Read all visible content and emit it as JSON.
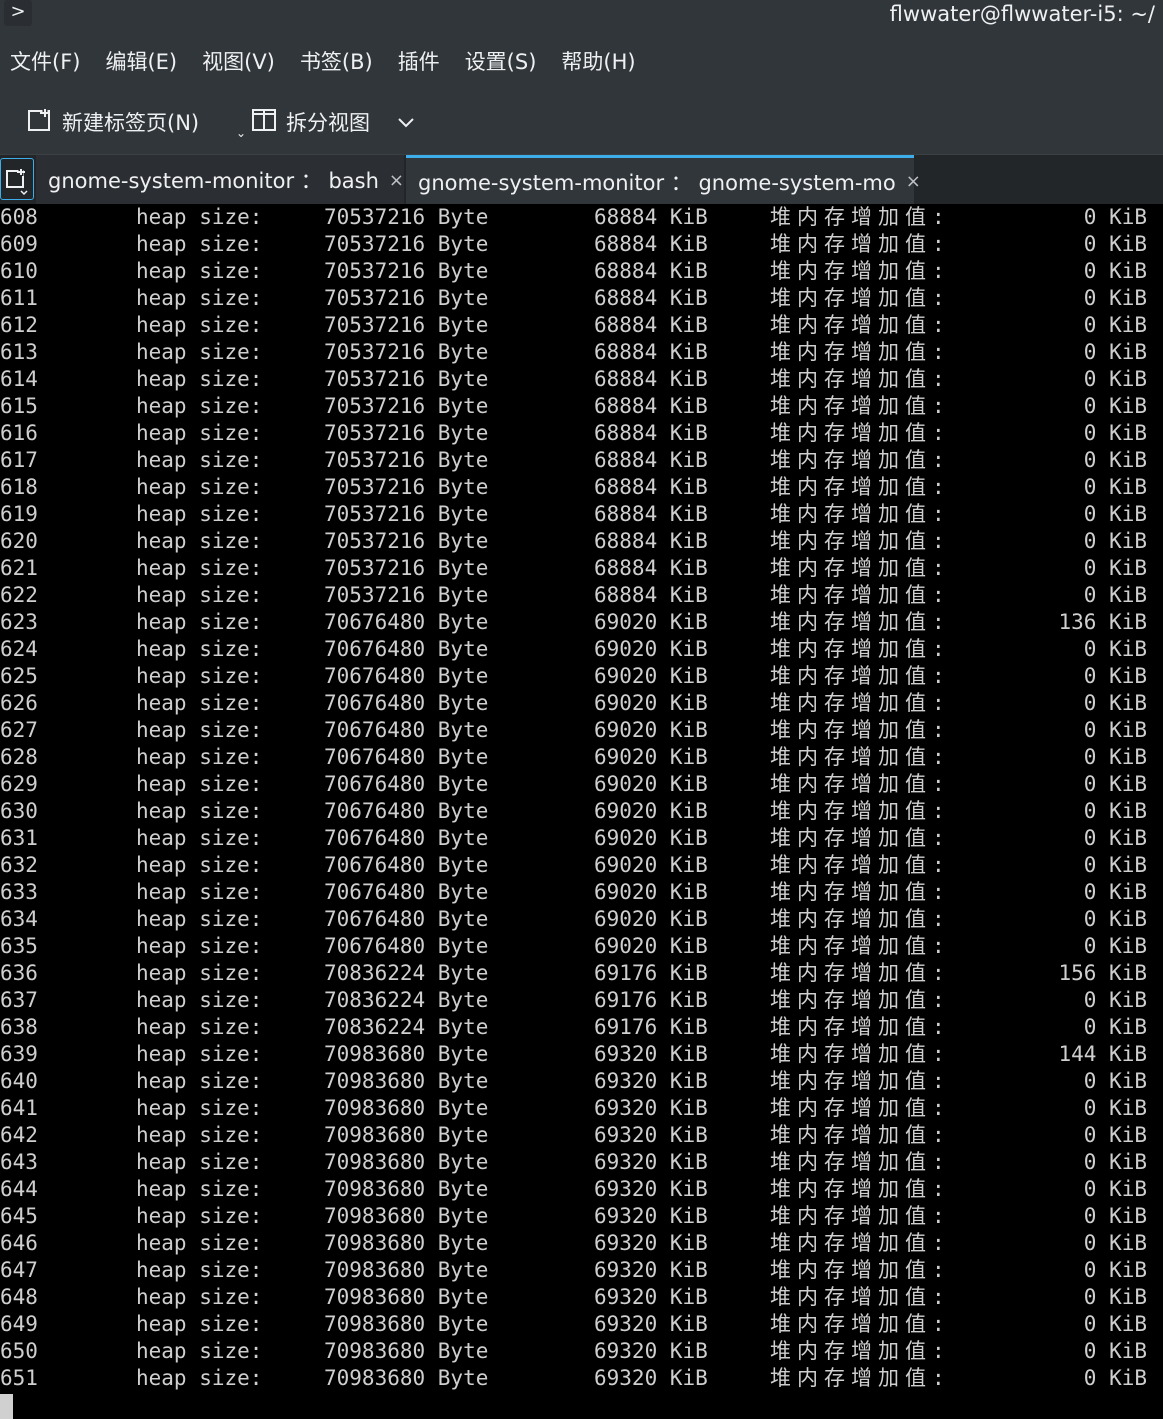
{
  "window": {
    "title": "flwwater@flwwater-i5:  ~/",
    "menu_button": ">"
  },
  "menubar": [
    "文件(F)",
    "编辑(E)",
    "视图(V)",
    "书签(B)",
    "插件",
    "设置(S)",
    "帮助(H)"
  ],
  "toolbar": {
    "new_tab_label": "新建标签页(N)",
    "split_view_label": "拆分视图",
    "new_tab_caret": "⌄",
    "more_glyph": "⌵"
  },
  "tabs": [
    {
      "label": "gnome-system-monitor ： bash",
      "close": "×",
      "active": false
    },
    {
      "label": "gnome-system-monitor ： gnome-system-mo",
      "close": "×",
      "active": true
    }
  ],
  "colors": {
    "accent": "#3daee9",
    "chrome_bg": "#31363b",
    "terminal_bg": "#000000",
    "terminal_fg": "#cfcfcf"
  },
  "terminal": {
    "lines": [
      {
        "idx": "608",
        "label": "heap size:",
        "bytes": "70537216 Byte",
        "kib": "68884 KiB",
        "cn": "堆内存增加值:",
        "inc": "0 KiB"
      },
      {
        "idx": "609",
        "label": "heap size:",
        "bytes": "70537216 Byte",
        "kib": "68884 KiB",
        "cn": "堆内存增加值:",
        "inc": "0 KiB"
      },
      {
        "idx": "610",
        "label": "heap size:",
        "bytes": "70537216 Byte",
        "kib": "68884 KiB",
        "cn": "堆内存增加值:",
        "inc": "0 KiB"
      },
      {
        "idx": "611",
        "label": "heap size:",
        "bytes": "70537216 Byte",
        "kib": "68884 KiB",
        "cn": "堆内存增加值:",
        "inc": "0 KiB"
      },
      {
        "idx": "612",
        "label": "heap size:",
        "bytes": "70537216 Byte",
        "kib": "68884 KiB",
        "cn": "堆内存增加值:",
        "inc": "0 KiB"
      },
      {
        "idx": "613",
        "label": "heap size:",
        "bytes": "70537216 Byte",
        "kib": "68884 KiB",
        "cn": "堆内存增加值:",
        "inc": "0 KiB"
      },
      {
        "idx": "614",
        "label": "heap size:",
        "bytes": "70537216 Byte",
        "kib": "68884 KiB",
        "cn": "堆内存增加值:",
        "inc": "0 KiB"
      },
      {
        "idx": "615",
        "label": "heap size:",
        "bytes": "70537216 Byte",
        "kib": "68884 KiB",
        "cn": "堆内存增加值:",
        "inc": "0 KiB"
      },
      {
        "idx": "616",
        "label": "heap size:",
        "bytes": "70537216 Byte",
        "kib": "68884 KiB",
        "cn": "堆内存增加值:",
        "inc": "0 KiB"
      },
      {
        "idx": "617",
        "label": "heap size:",
        "bytes": "70537216 Byte",
        "kib": "68884 KiB",
        "cn": "堆内存增加值:",
        "inc": "0 KiB"
      },
      {
        "idx": "618",
        "label": "heap size:",
        "bytes": "70537216 Byte",
        "kib": "68884 KiB",
        "cn": "堆内存增加值:",
        "inc": "0 KiB"
      },
      {
        "idx": "619",
        "label": "heap size:",
        "bytes": "70537216 Byte",
        "kib": "68884 KiB",
        "cn": "堆内存增加值:",
        "inc": "0 KiB"
      },
      {
        "idx": "620",
        "label": "heap size:",
        "bytes": "70537216 Byte",
        "kib": "68884 KiB",
        "cn": "堆内存增加值:",
        "inc": "0 KiB"
      },
      {
        "idx": "621",
        "label": "heap size:",
        "bytes": "70537216 Byte",
        "kib": "68884 KiB",
        "cn": "堆内存增加值:",
        "inc": "0 KiB"
      },
      {
        "idx": "622",
        "label": "heap size:",
        "bytes": "70537216 Byte",
        "kib": "68884 KiB",
        "cn": "堆内存增加值:",
        "inc": "0 KiB"
      },
      {
        "idx": "623",
        "label": "heap size:",
        "bytes": "70676480 Byte",
        "kib": "69020 KiB",
        "cn": "堆内存增加值:",
        "inc": "136 KiB"
      },
      {
        "idx": "624",
        "label": "heap size:",
        "bytes": "70676480 Byte",
        "kib": "69020 KiB",
        "cn": "堆内存增加值:",
        "inc": "0 KiB"
      },
      {
        "idx": "625",
        "label": "heap size:",
        "bytes": "70676480 Byte",
        "kib": "69020 KiB",
        "cn": "堆内存增加值:",
        "inc": "0 KiB"
      },
      {
        "idx": "626",
        "label": "heap size:",
        "bytes": "70676480 Byte",
        "kib": "69020 KiB",
        "cn": "堆内存增加值:",
        "inc": "0 KiB"
      },
      {
        "idx": "627",
        "label": "heap size:",
        "bytes": "70676480 Byte",
        "kib": "69020 KiB",
        "cn": "堆内存增加值:",
        "inc": "0 KiB"
      },
      {
        "idx": "628",
        "label": "heap size:",
        "bytes": "70676480 Byte",
        "kib": "69020 KiB",
        "cn": "堆内存增加值:",
        "inc": "0 KiB"
      },
      {
        "idx": "629",
        "label": "heap size:",
        "bytes": "70676480 Byte",
        "kib": "69020 KiB",
        "cn": "堆内存增加值:",
        "inc": "0 KiB"
      },
      {
        "idx": "630",
        "label": "heap size:",
        "bytes": "70676480 Byte",
        "kib": "69020 KiB",
        "cn": "堆内存增加值:",
        "inc": "0 KiB"
      },
      {
        "idx": "631",
        "label": "heap size:",
        "bytes": "70676480 Byte",
        "kib": "69020 KiB",
        "cn": "堆内存增加值:",
        "inc": "0 KiB"
      },
      {
        "idx": "632",
        "label": "heap size:",
        "bytes": "70676480 Byte",
        "kib": "69020 KiB",
        "cn": "堆内存增加值:",
        "inc": "0 KiB"
      },
      {
        "idx": "633",
        "label": "heap size:",
        "bytes": "70676480 Byte",
        "kib": "69020 KiB",
        "cn": "堆内存增加值:",
        "inc": "0 KiB"
      },
      {
        "idx": "634",
        "label": "heap size:",
        "bytes": "70676480 Byte",
        "kib": "69020 KiB",
        "cn": "堆内存增加值:",
        "inc": "0 KiB"
      },
      {
        "idx": "635",
        "label": "heap size:",
        "bytes": "70676480 Byte",
        "kib": "69020 KiB",
        "cn": "堆内存增加值:",
        "inc": "0 KiB"
      },
      {
        "idx": "636",
        "label": "heap size:",
        "bytes": "70836224 Byte",
        "kib": "69176 KiB",
        "cn": "堆内存增加值:",
        "inc": "156 KiB"
      },
      {
        "idx": "637",
        "label": "heap size:",
        "bytes": "70836224 Byte",
        "kib": "69176 KiB",
        "cn": "堆内存增加值:",
        "inc": "0 KiB"
      },
      {
        "idx": "638",
        "label": "heap size:",
        "bytes": "70836224 Byte",
        "kib": "69176 KiB",
        "cn": "堆内存增加值:",
        "inc": "0 KiB"
      },
      {
        "idx": "639",
        "label": "heap size:",
        "bytes": "70983680 Byte",
        "kib": "69320 KiB",
        "cn": "堆内存增加值:",
        "inc": "144 KiB"
      },
      {
        "idx": "640",
        "label": "heap size:",
        "bytes": "70983680 Byte",
        "kib": "69320 KiB",
        "cn": "堆内存增加值:",
        "inc": "0 KiB"
      },
      {
        "idx": "641",
        "label": "heap size:",
        "bytes": "70983680 Byte",
        "kib": "69320 KiB",
        "cn": "堆内存增加值:",
        "inc": "0 KiB"
      },
      {
        "idx": "642",
        "label": "heap size:",
        "bytes": "70983680 Byte",
        "kib": "69320 KiB",
        "cn": "堆内存增加值:",
        "inc": "0 KiB"
      },
      {
        "idx": "643",
        "label": "heap size:",
        "bytes": "70983680 Byte",
        "kib": "69320 KiB",
        "cn": "堆内存增加值:",
        "inc": "0 KiB"
      },
      {
        "idx": "644",
        "label": "heap size:",
        "bytes": "70983680 Byte",
        "kib": "69320 KiB",
        "cn": "堆内存增加值:",
        "inc": "0 KiB"
      },
      {
        "idx": "645",
        "label": "heap size:",
        "bytes": "70983680 Byte",
        "kib": "69320 KiB",
        "cn": "堆内存增加值:",
        "inc": "0 KiB"
      },
      {
        "idx": "646",
        "label": "heap size:",
        "bytes": "70983680 Byte",
        "kib": "69320 KiB",
        "cn": "堆内存增加值:",
        "inc": "0 KiB"
      },
      {
        "idx": "647",
        "label": "heap size:",
        "bytes": "70983680 Byte",
        "kib": "69320 KiB",
        "cn": "堆内存增加值:",
        "inc": "0 KiB"
      },
      {
        "idx": "648",
        "label": "heap size:",
        "bytes": "70983680 Byte",
        "kib": "69320 KiB",
        "cn": "堆内存增加值:",
        "inc": "0 KiB"
      },
      {
        "idx": "649",
        "label": "heap size:",
        "bytes": "70983680 Byte",
        "kib": "69320 KiB",
        "cn": "堆内存增加值:",
        "inc": "0 KiB"
      },
      {
        "idx": "650",
        "label": "heap size:",
        "bytes": "70983680 Byte",
        "kib": "69320 KiB",
        "cn": "堆内存增加值:",
        "inc": "0 KiB"
      },
      {
        "idx": "651",
        "label": "heap size:",
        "bytes": "70983680 Byte",
        "kib": "69320 KiB",
        "cn": "堆内存增加值:",
        "inc": "0 KiB"
      }
    ]
  }
}
